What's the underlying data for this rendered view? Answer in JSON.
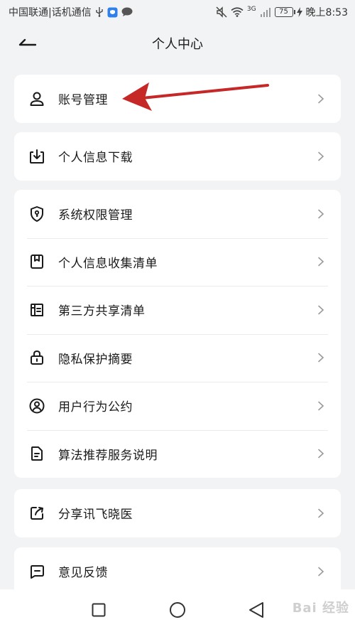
{
  "status_bar": {
    "carrier": "中国联通|话机通信",
    "network_label": "3G",
    "battery": "75",
    "time": "晚上8:53"
  },
  "header": {
    "title": "个人中心"
  },
  "sections": [
    {
      "items": [
        {
          "label": "账号管理",
          "icon": "user-icon"
        }
      ]
    },
    {
      "items": [
        {
          "label": "个人信息下载",
          "icon": "download-icon"
        }
      ]
    },
    {
      "items": [
        {
          "label": "系统权限管理",
          "icon": "shield-key-icon"
        },
        {
          "label": "个人信息收集清单",
          "icon": "bookmark-doc-icon"
        },
        {
          "label": "第三方共享清单",
          "icon": "share-list-icon"
        },
        {
          "label": "隐私保护摘要",
          "icon": "lock-icon"
        },
        {
          "label": "用户行为公约",
          "icon": "user-circle-icon"
        },
        {
          "label": "算法推荐服务说明",
          "icon": "document-icon"
        }
      ]
    },
    {
      "items": [
        {
          "label": "分享讯飞晓医",
          "icon": "share-icon"
        }
      ]
    },
    {
      "items": [
        {
          "label": "意见反馈",
          "icon": "feedback-icon"
        }
      ]
    }
  ],
  "watermark": "Bai 经验",
  "colors": {
    "background": "#f2f3f5",
    "card": "#ffffff",
    "annotation_arrow": "#c62828"
  }
}
